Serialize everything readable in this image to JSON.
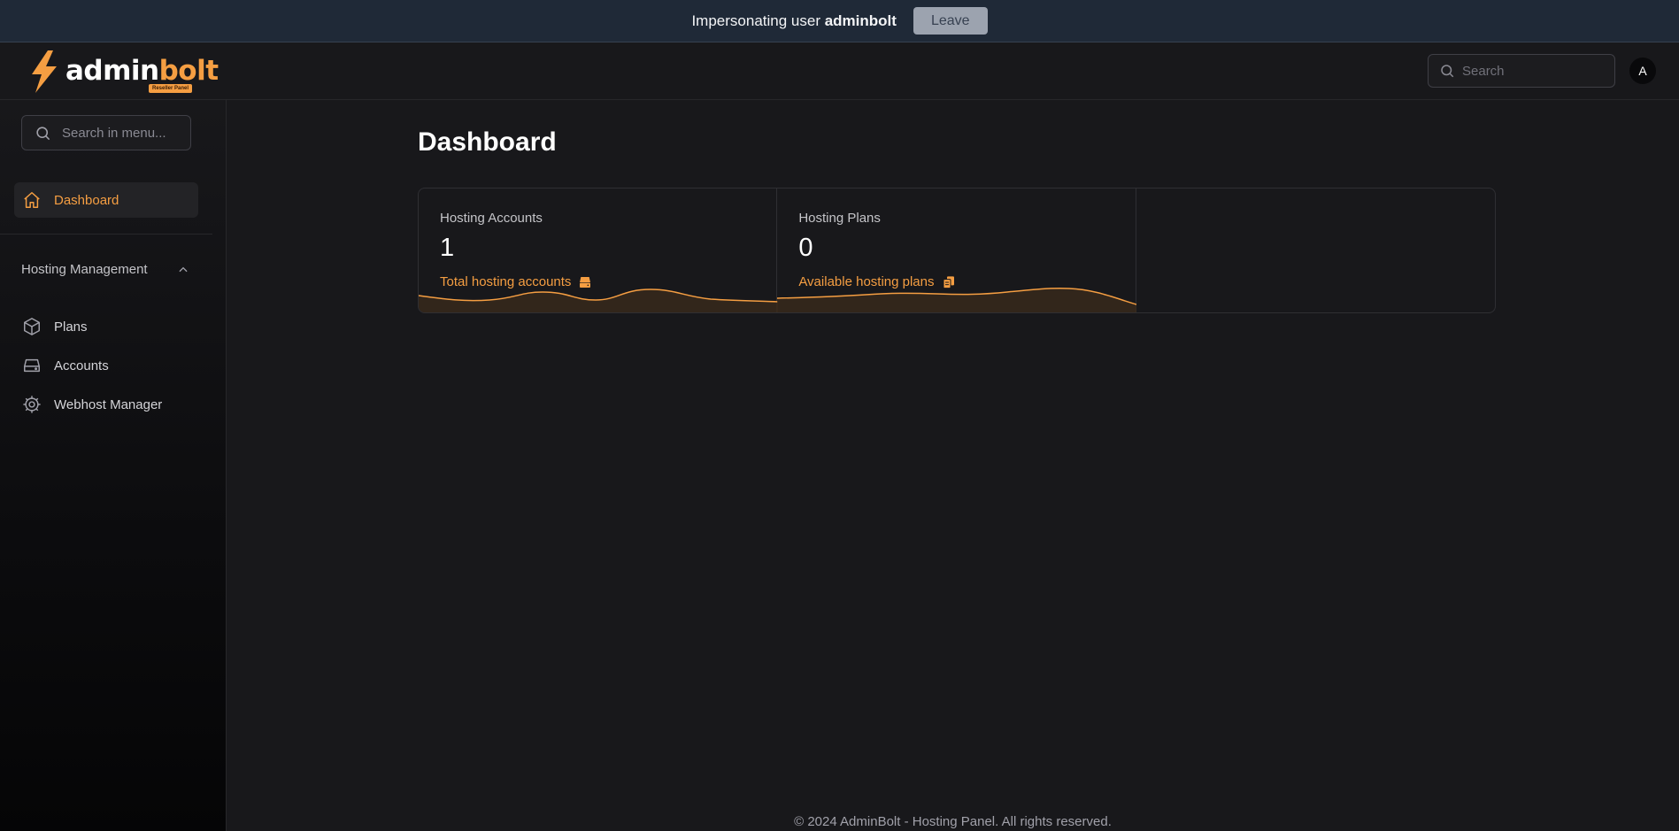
{
  "impersonation": {
    "prefix": "Impersonating user",
    "username": "adminbolt",
    "leave_label": "Leave"
  },
  "header": {
    "logo_text_1": "admin",
    "logo_text_2": "bolt",
    "logo_badge": "Reseller Panel",
    "search_placeholder": "Search",
    "avatar_initial": "A"
  },
  "sidebar": {
    "search_placeholder": "Search in menu...",
    "items": [
      {
        "label": "Dashboard",
        "icon": "home-icon",
        "active": true
      }
    ],
    "group": {
      "title": "Hosting Management",
      "items": [
        {
          "label": "Plans",
          "icon": "cube-icon"
        },
        {
          "label": "Accounts",
          "icon": "server-icon"
        },
        {
          "label": "Webhost Manager",
          "icon": "cog-icon"
        }
      ]
    }
  },
  "main": {
    "title": "Dashboard",
    "stats": [
      {
        "label": "Hosting Accounts",
        "value": "1",
        "description": "Total hosting accounts",
        "icon": "server-stack-icon"
      },
      {
        "label": "Hosting Plans",
        "value": "0",
        "description": "Available hosting plans",
        "icon": "documents-icon"
      }
    ]
  },
  "footer": {
    "text": "© 2024 AdminBolt - Hosting Panel. All rights reserved."
  },
  "colors": {
    "accent": "#f59e42",
    "background": "#18181b",
    "impersonation_bar": "#1f2937"
  }
}
